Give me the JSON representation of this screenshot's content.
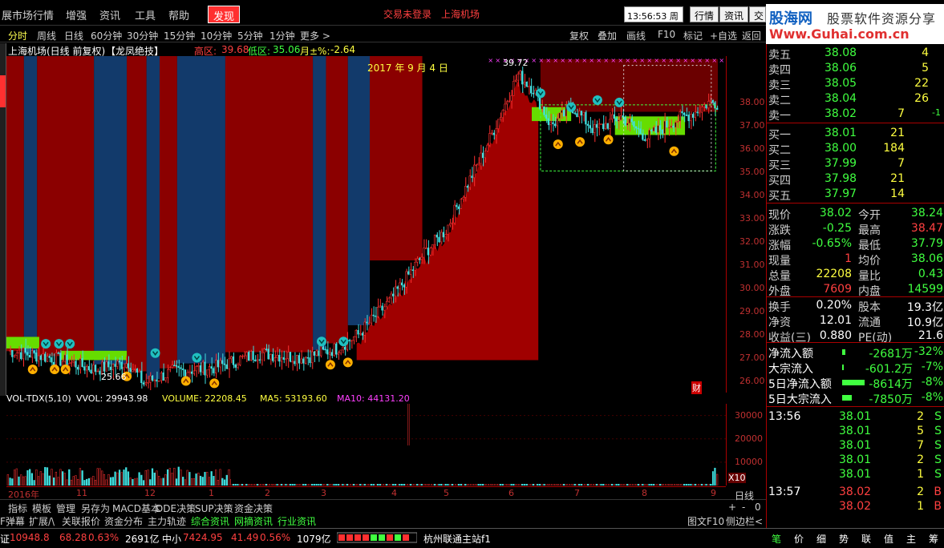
{
  "menu": {
    "items": [
      "展市场行情",
      "增强",
      "资讯",
      "工具",
      "帮助"
    ],
    "discover": "发现",
    "status1": "交易未登录",
    "status2": "上海机场",
    "clock": "13:56:53 周一",
    "right_buttons": [
      "行情",
      "资讯",
      "交"
    ]
  },
  "watermark": {
    "brand": "股海网",
    "slogan": "股票软件资源分享",
    "url": "Www.Guhai.com.cn"
  },
  "periods": [
    "分时",
    "周线",
    "日线",
    "60分钟",
    "30分钟",
    "15分钟",
    "10分钟",
    "5分钟",
    "1分钟",
    "更多 >"
  ],
  "period_selected_index": 0,
  "toolbar_right": [
    "复权",
    "叠加",
    "画线",
    "F10",
    "标记",
    "+自选",
    "返回"
  ],
  "info": {
    "stock": "上海机场(日线 前复权)",
    "indicator": "【龙凤绝技】",
    "high_label": "高区:",
    "high": "39.68",
    "low_label": "低区:",
    "low": "35.06",
    "month_label": "月±%:",
    "month": "-2.64"
  },
  "annotations": {
    "date": "2017 年 9 月 4 日",
    "peak": "39.72",
    "low": "25.66",
    "cai": "财"
  },
  "vol_header": {
    "name": "VOL-TDX(5,10)",
    "vvol": "VVOL: 29943.98",
    "volume": "VOLUME: 22208.45",
    "ma5": "MA5: 53193.60",
    "ma10": "MA10: 44131.20"
  },
  "y_labels": [
    "38.00",
    "37.00",
    "36.00",
    "35.00",
    "34.00",
    "33.00",
    "32.00",
    "31.00",
    "30.00",
    "29.00",
    "28.00",
    "27.00",
    "26.00"
  ],
  "vol_labels": [
    "30000",
    "20000",
    "10000",
    "X10"
  ],
  "date_labels": [
    "2016年",
    "11",
    "12",
    "1",
    "2",
    "3",
    "4",
    "5",
    "6",
    "7",
    "8",
    "9"
  ],
  "tabs1": [
    "指标",
    "模板",
    "管理",
    "另存为",
    "MACD基本",
    "DDE决策",
    "SUP决策",
    "资金决策"
  ],
  "tabs1_right": [
    "日线",
    "+",
    "-",
    "0"
  ],
  "tabs2": [
    "F弹幕",
    "扩展/\\",
    "关联报价",
    "资金分布",
    "主力轨迹",
    "综合资讯",
    "网摘资讯",
    "行业资讯"
  ],
  "tabs2_right": [
    "图文F10",
    "侧边栏<"
  ],
  "statusbar": {
    "idx1_label": "证",
    "idx1_val": "10948.8",
    "idx1_chg": "68.28",
    "idx1_pct": "0.63%",
    "idx1_amt": "2691亿",
    "idx2_label": "中小",
    "idx2_val": "7424.95",
    "idx2_chg": "41.49",
    "idx2_pct": "0.56%",
    "idx2_amt": "1079亿",
    "server": "杭州联通主站f1",
    "right_items": [
      "笔",
      "价",
      "细",
      "势",
      "联",
      "值",
      "主",
      "筹"
    ]
  },
  "order_book": {
    "asks": [
      {
        "label": "卖五",
        "price": "38.08",
        "vol": "4"
      },
      {
        "label": "卖四",
        "price": "38.06",
        "vol": "5"
      },
      {
        "label": "卖三",
        "price": "38.05",
        "vol": "22"
      },
      {
        "label": "卖二",
        "price": "38.04",
        "vol": "26"
      },
      {
        "label": "卖一",
        "price": "38.02",
        "vol": "7",
        "extra": "-1"
      }
    ],
    "bids": [
      {
        "label": "买一",
        "price": "38.01",
        "vol": "21"
      },
      {
        "label": "买二",
        "price": "38.00",
        "vol": "184"
      },
      {
        "label": "买三",
        "price": "37.99",
        "vol": "7"
      },
      {
        "label": "买四",
        "price": "37.98",
        "vol": "21"
      },
      {
        "label": "买五",
        "price": "37.97",
        "vol": "14"
      }
    ]
  },
  "quote": [
    {
      "l1": "现价",
      "v1": "38.02",
      "l2": "今开",
      "v2": "38.24"
    },
    {
      "l1": "涨跌",
      "v1": "-0.25",
      "l2": "最高",
      "v2": "38.47"
    },
    {
      "l1": "涨幅",
      "v1": "-0.65%",
      "l2": "最低",
      "v2": "37.79"
    },
    {
      "l1": "现量",
      "v1": "1",
      "l2": "均价",
      "v2": "38.06"
    },
    {
      "l1": "总量",
      "v1": "22208",
      "l2": "量比",
      "v2": "0.43"
    },
    {
      "l1": "外盘",
      "v1": "7609",
      "l2": "内盘",
      "v2": "14599"
    }
  ],
  "fundamentals": [
    {
      "l1": "换手",
      "v1": "0.20%",
      "l2": "股本",
      "v2": "19.3亿"
    },
    {
      "l1": "净资",
      "v1": "12.01",
      "l2": "流通",
      "v2": "10.9亿"
    },
    {
      "l1": "收益(三)",
      "v1": "0.880",
      "l2": "PE(动)",
      "v2": "21.6"
    }
  ],
  "flows": [
    {
      "label": "净流入额",
      "val": "-2681万",
      "pct": "-32%"
    },
    {
      "label": "大宗流入",
      "val": "-601.2万",
      "pct": "-7%"
    },
    {
      "label": "5日净流入额",
      "val": "-8614万",
      "pct": "-8%"
    },
    {
      "label": "5日大宗流入",
      "val": "-7850万",
      "pct": "-8%"
    }
  ],
  "ticks": [
    {
      "time": "13:56",
      "price": "38.01",
      "vol": "2",
      "side": "S"
    },
    {
      "time": "",
      "price": "38.01",
      "vol": "5",
      "side": "S"
    },
    {
      "time": "",
      "price": "38.01",
      "vol": "7",
      "side": "S"
    },
    {
      "time": "",
      "price": "38.01",
      "vol": "2",
      "side": "S"
    },
    {
      "time": "",
      "price": "38.01",
      "vol": "1",
      "side": "S"
    },
    {
      "time": "13:57",
      "price": "38.02",
      "vol": "2",
      "side": "B"
    },
    {
      "time": "",
      "price": "38.02",
      "vol": "1",
      "side": "B"
    }
  ],
  "chart_data": {
    "type": "candlestick",
    "ylim": [
      25.5,
      40.0
    ],
    "yticks": [
      26,
      27,
      28,
      29,
      30,
      31,
      32,
      33,
      34,
      35,
      36,
      37,
      38
    ],
    "vol_ylim": [
      0,
      35000
    ],
    "vol_yticks": [
      10000,
      20000,
      30000
    ],
    "colors": {
      "up": "#ff3030",
      "down": "#40e0e0",
      "zone_red": "#8b0000",
      "zone_blue": "#123a6b",
      "zone_green": "#66dd00"
    },
    "waypoints": [
      [
        0,
        27.3
      ],
      [
        20,
        27.0
      ],
      [
        40,
        26.5
      ],
      [
        55,
        26.8
      ],
      [
        62,
        25.9
      ],
      [
        75,
        26.4
      ],
      [
        95,
        26.6
      ],
      [
        115,
        27.2
      ],
      [
        135,
        27.0
      ],
      [
        150,
        27.4
      ],
      [
        160,
        28.0
      ],
      [
        175,
        29.5
      ],
      [
        190,
        31.5
      ],
      [
        200,
        32.5
      ],
      [
        210,
        34.5
      ],
      [
        218,
        36.0
      ],
      [
        225,
        37.5
      ],
      [
        233,
        39.2
      ],
      [
        240,
        38.6
      ],
      [
        248,
        37.0
      ],
      [
        258,
        37.8
      ],
      [
        268,
        36.8
      ],
      [
        280,
        37.4
      ],
      [
        292,
        36.5
      ],
      [
        304,
        37.2
      ],
      [
        314,
        37.6
      ],
      [
        320,
        38.0
      ]
    ]
  }
}
